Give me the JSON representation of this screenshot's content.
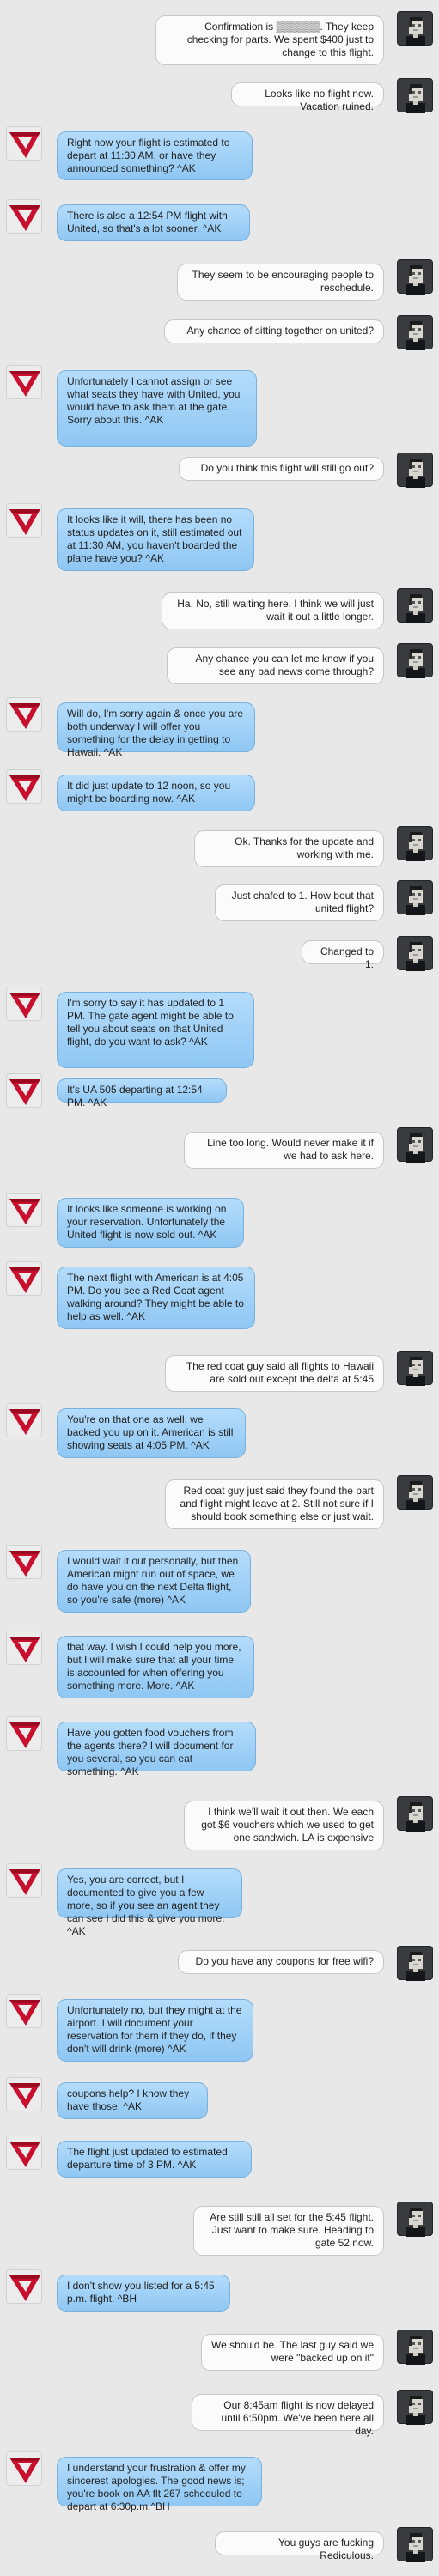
{
  "conversation": {
    "messages": [
      {
        "from": "user",
        "text": "Confirmation is ▒▒▒▒▒▒. They keep checking for parts. We spent $400 just to change to this flight."
      },
      {
        "from": "user",
        "text": "Looks like no flight now. Vacation ruined."
      },
      {
        "from": "agent",
        "text": "Right now your flight is estimated to depart at 11:30 AM, or have they announced something? ^AK"
      },
      {
        "from": "agent",
        "text": "There is also a 12:54 PM flight with United, so that's a lot sooner. ^AK"
      },
      {
        "from": "user",
        "text": "They seem to be encouraging people to reschedule."
      },
      {
        "from": "user",
        "text": "Any chance of sitting together on united?"
      },
      {
        "from": "agent",
        "text": "Unfortunately I cannot assign or see what seats they have with United, you would have to ask them at the gate. Sorry about this. ^AK"
      },
      {
        "from": "user",
        "text": "Do you think this flight will still go out?"
      },
      {
        "from": "agent",
        "text": "It looks like it will, there has been no status updates on it, still estimated out at 11:30 AM, you haven't boarded the plane have you? ^AK"
      },
      {
        "from": "user",
        "text": "Ha. No, still waiting here. I think we will just wait it out a little longer."
      },
      {
        "from": "user",
        "text": "Any chance you can let me know if you see any bad news come through?"
      },
      {
        "from": "agent",
        "text": "Will do, I'm sorry again & once you are both underway I will offer you something for the delay in getting to Hawaii. ^AK"
      },
      {
        "from": "agent",
        "text": "It did just update to 12 noon, so you might be boarding now. ^AK"
      },
      {
        "from": "user",
        "text": "Ok. Thanks for the update and working with me."
      },
      {
        "from": "user",
        "text": "Just chafed to 1. How bout that united flight?"
      },
      {
        "from": "user",
        "text": "Changed to 1."
      },
      {
        "from": "agent",
        "text": "I'm sorry to say it has updated to 1 PM. The gate agent might be able to tell you about seats on that United flight, do you want to ask? ^AK"
      },
      {
        "from": "agent",
        "text": "It's UA 505 departing at 12:54 PM. ^AK"
      },
      {
        "from": "user",
        "text": "Line too long. Would never make it if we had to ask here."
      },
      {
        "from": "agent",
        "text": "It looks like someone is working on your reservation. Unfortunately the United flight is now sold out. ^AK"
      },
      {
        "from": "agent",
        "text": "The next flight with American is at 4:05 PM. Do you see a Red Coat agent walking around? They might be able to help as well. ^AK"
      },
      {
        "from": "user",
        "text": "The red coat guy said all flights to Hawaii are sold out except the delta at 5:45"
      },
      {
        "from": "agent",
        "text": "You're on that one as well, we backed you up on it. American is still showing seats at 4:05 PM.  ^AK"
      },
      {
        "from": "user",
        "text": "Red coat guy just said they found the part and flight might leave at 2. Still not sure if I should book something else or just wait."
      },
      {
        "from": "agent",
        "text": "I would wait it out personally, but then American might run out of space, we do have you on the next Delta flight, so you're safe (more) ^AK"
      },
      {
        "from": "agent",
        "text": "that way. I wish I could help you more, but I will make sure that all your time is accounted for when offering you something more. More. ^AK"
      },
      {
        "from": "agent",
        "text": "Have you gotten food vouchers from the agents there? I will document for you several, so you can eat something. ^AK"
      },
      {
        "from": "user",
        "text": "I think we'll wait it out then. We each got $6 vouchers which we used to get one sandwich. LA is expensive"
      },
      {
        "from": "agent",
        "text": "Yes, you are correct, but I documented to give you a few more, so if you see an agent they can see I did this & give you more. ^AK"
      },
      {
        "from": "user",
        "text": "Do you have any coupons for free wifi?"
      },
      {
        "from": "agent",
        "text": "Unfortunately no, but they might at the airport. I will document your reservation for them if they do, if they don't will drink (more) ^AK"
      },
      {
        "from": "agent",
        "text": "coupons help? I know they have those. ^AK"
      },
      {
        "from": "agent",
        "text": "The flight just updated to estimated departure time of 3 PM.  ^AK"
      },
      {
        "from": "user",
        "text": "Are still still all set for the 5:45 flight. Just want to make sure. Heading to gate 52 now."
      },
      {
        "from": "agent",
        "text": "I don't show you listed for a 5:45 p.m. flight.  ^BH"
      },
      {
        "from": "user",
        "text": "We should be. The last guy said we were \"backed up on it\""
      },
      {
        "from": "user",
        "text": "Our 8:45am flight is now delayed until 6:50pm. We've been here all day."
      },
      {
        "from": "agent",
        "text": "I understand your frustration & offer my sincerest apologies. The good news is; you're book on AA flt 267 scheduled to depart at 6:30p.m.^BH"
      },
      {
        "from": "user",
        "text": "You guys are fucking Rediculous."
      }
    ]
  },
  "colors": {
    "background": "#e8e8e8",
    "agent_bubble": "#a3d2f8",
    "user_bubble": "#fbfbfb",
    "airline_logo_red": "#c8102e",
    "user_avatar": "#3a3b3f"
  },
  "icons": {
    "agent_avatar": "delta-widget-logo-icon",
    "user_avatar": "pixel-portrait-icon"
  }
}
